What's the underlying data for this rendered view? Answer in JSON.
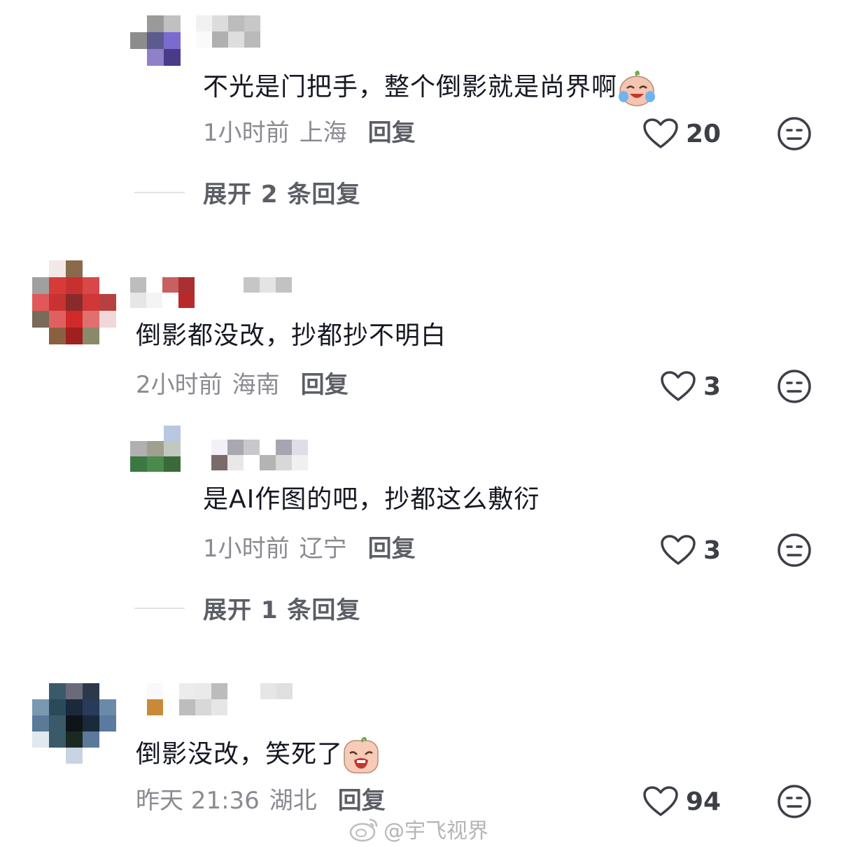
{
  "comments": [
    {
      "text": "不光是门把手，整个倒影就是尚界啊",
      "emoji_icon": "crying-laughing-emoji-icon",
      "time": "1小时前",
      "location": "上海",
      "reply_label": "回复",
      "likes": "20",
      "expand_label": "展开 2 条回复"
    },
    {
      "text": "倒影都没改，抄都抄不明白",
      "time": "2小时前",
      "location": "海南",
      "reply_label": "回复",
      "likes": "3"
    },
    {
      "text": "是AI作图的吧，抄都这么敷衍",
      "time": "1小时前",
      "location": "辽宁",
      "reply_label": "回复",
      "likes": "3",
      "expand_label": "展开 1 条回复"
    },
    {
      "text": "倒影没改，笑死了",
      "emoji_icon": "laughing-crying-emoji-icon",
      "time": "昨天 21:36",
      "location": "湖北",
      "reply_label": "回复",
      "likes": "94"
    }
  ],
  "watermark": {
    "icon": "weibo-logo-icon",
    "text": "@宇飞视界"
  },
  "colors": {
    "text": "#161823",
    "meta": "#8a8b91",
    "icon": "#3d3f47",
    "blur_avatar_1": [
      "#a0a0a0",
      "#5a5a8a",
      "#7a6ad0",
      "#4a3a8a"
    ],
    "blur_avatar_2": [
      "#d03030",
      "#7a5030",
      "#a03030",
      "#e05050"
    ],
    "blur_avatar_3": [
      "#4a7a4a",
      "#a8a8a8",
      "#b0c0d0"
    ],
    "blur_avatar_4": [
      "#2a4a5a",
      "#5a7a9a",
      "#1a1a2a",
      "#7a9aba"
    ]
  }
}
